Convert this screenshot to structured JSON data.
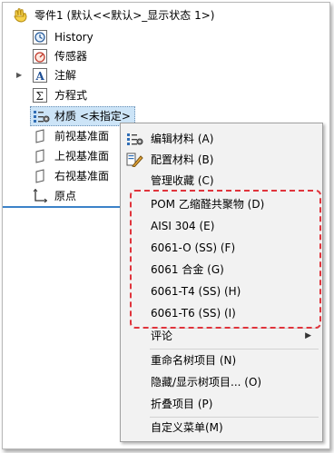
{
  "tree": {
    "root_label": "零件1  (默认<<默认>_显示状态 1>)",
    "items": [
      {
        "label": "History",
        "icon": "history-icon"
      },
      {
        "label": "传感器",
        "icon": "sensor-icon"
      },
      {
        "label": "注解",
        "icon": "annotation-icon",
        "expandable": true
      },
      {
        "label": "方程式",
        "icon": "equation-icon"
      },
      {
        "label": "材质 <未指定>",
        "icon": "material-icon",
        "selected": true
      },
      {
        "label": "前视基准面",
        "icon": "plane-icon"
      },
      {
        "label": "上视基准面",
        "icon": "plane-icon"
      },
      {
        "label": "右视基准面",
        "icon": "plane-icon"
      },
      {
        "label": "原点",
        "icon": "origin-icon"
      }
    ]
  },
  "context_menu": {
    "top": [
      {
        "label": "编辑材料 (A)",
        "icon": "edit-material-icon"
      },
      {
        "label": "配置材料 (B)",
        "icon": "configure-material-icon"
      },
      {
        "label": "管理收藏 (C)"
      }
    ],
    "favorites": [
      {
        "label": "POM 乙缩醛共聚物 (D)"
      },
      {
        "label": "AISI 304 (E)"
      },
      {
        "label": "6061-O (SS) (F)"
      },
      {
        "label": "6061 合金 (G)"
      },
      {
        "label": "6061-T4 (SS) (H)"
      },
      {
        "label": "6061-T6 (SS) (I)"
      }
    ],
    "comment": {
      "label": "评论",
      "submenu_arrow": "▶"
    },
    "tree_items": [
      {
        "label": "重命名树项目 (N)"
      },
      {
        "label": "隐藏/显示树项目... (O)"
      },
      {
        "label": "折叠项目 (P)"
      }
    ],
    "customize": {
      "label": "自定义菜单(M)"
    }
  },
  "colors": {
    "selection": "#cce4f7",
    "highlight_box": "#e0343c",
    "tree_bar": "#3c82c8"
  }
}
